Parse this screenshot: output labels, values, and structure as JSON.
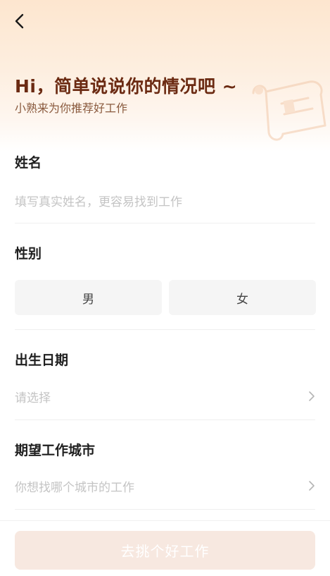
{
  "header": {
    "back_icon": "chevron-left-icon",
    "title": "Hi，简单说说你的情况吧 ~",
    "subtitle": "小熟来为你推荐好工作"
  },
  "form": {
    "name": {
      "label": "姓名",
      "placeholder": "填写真实姓名，更容易找到工作"
    },
    "gender": {
      "label": "性别",
      "options": [
        "男",
        "女"
      ]
    },
    "birth_date": {
      "label": "出生日期",
      "placeholder": "请选择",
      "icon": "chevron-right-icon"
    },
    "city": {
      "label": "期望工作城市",
      "placeholder": "你想找哪个城市的工作",
      "icon": "chevron-right-icon"
    }
  },
  "submit": {
    "label": "去挑个好工作"
  },
  "colors": {
    "title": "#6b2a12",
    "subtitle": "#8a5a3e",
    "hero_top": "#fde6cf",
    "placeholder": "#c4c4c4",
    "button_disabled_bg": "#f7e8e0",
    "gender_bg": "#f5f5f5"
  }
}
